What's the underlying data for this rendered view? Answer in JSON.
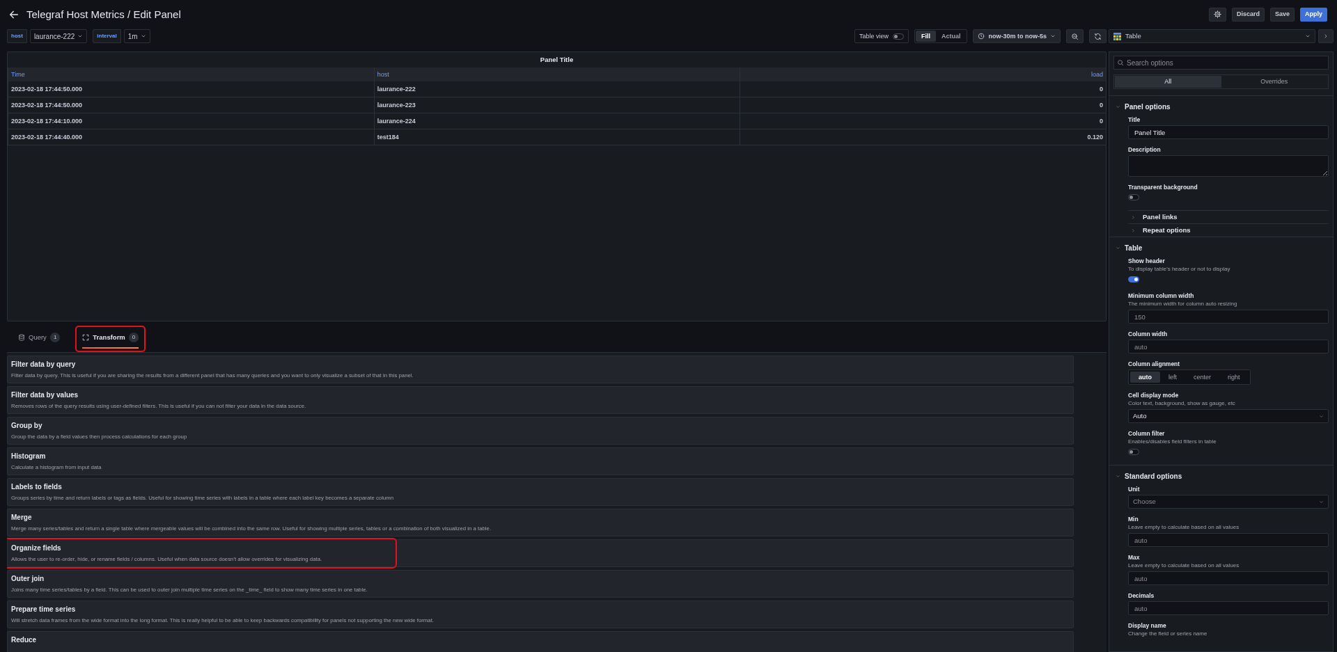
{
  "header": {
    "title": "Telegraf Host Metrics / Edit Panel",
    "buttons": [
      {
        "label": "Discard",
        "kind": "secondary"
      },
      {
        "label": "Save",
        "kind": "secondary"
      },
      {
        "label": "Apply",
        "kind": "primary"
      }
    ]
  },
  "variables": [
    {
      "label": "host",
      "value": "laurance-222"
    },
    {
      "label": "interval",
      "value": "1m"
    }
  ],
  "toolbar": {
    "table_view": {
      "label": "Table view",
      "on": false
    },
    "display_modes": [
      {
        "label": "Fill",
        "selected": true
      },
      {
        "label": "Actual",
        "selected": false
      }
    ],
    "time_range": "now-30m to now-5s"
  },
  "panel": {
    "title": "Panel Title",
    "table": {
      "columns": [
        {
          "label": "Time"
        },
        {
          "label": "host"
        },
        {
          "label": "load"
        }
      ],
      "rows": [
        [
          "2023-02-18 17:44:50.000",
          "laurance-222",
          "0"
        ],
        [
          "2023-02-18 17:44:50.000",
          "laurance-223",
          "0"
        ],
        [
          "2023-02-18 17:44:10.000",
          "laurance-224",
          "0"
        ],
        [
          "2023-02-18 17:44:40.000",
          "test184",
          "0.120"
        ]
      ]
    }
  },
  "tabs": [
    {
      "label": "Query",
      "count": "1",
      "selected": false,
      "highlighted": false
    },
    {
      "label": "Transform",
      "count": "0",
      "selected": true,
      "highlighted": true
    }
  ],
  "transformations": [
    {
      "title": "Filter data by query",
      "description": "Filter data by query. This is useful if you are sharing the results from a different panel that has many queries and you want to only visualize a subset of that in this panel.",
      "highlighted": false
    },
    {
      "title": "Filter data by values",
      "description": "Removes rows of the query results using user-defined filters. This is useful if you can not filter your data in the data source.",
      "highlighted": false
    },
    {
      "title": "Group by",
      "description": "Group the data by a field values then process calculations for each group",
      "highlighted": false
    },
    {
      "title": "Histogram",
      "description": "Calculate a histogram from input data",
      "highlighted": false
    },
    {
      "title": "Labels to fields",
      "description": "Groups series by time and return labels or tags as fields. Useful for showing time series with labels in a table where each label key becomes a separate column",
      "highlighted": false
    },
    {
      "title": "Merge",
      "description": "Merge many series/tables and return a single table where mergeable values will be combined into the same row. Useful for showing multiple series, tables or a combination of both visualized in a table.",
      "highlighted": false
    },
    {
      "title": "Organize fields",
      "description": "Allows the user to re-order, hide, or rename fields / columns. Useful when data source doesn't allow overrides for visualizing data.",
      "highlighted": true
    },
    {
      "title": "Outer join",
      "description": "Joins many time series/tables by a field. This can be used to outer join multiple time series on the _time_ field to show many time series in one table.",
      "highlighted": false
    },
    {
      "title": "Prepare time series",
      "description": "Will stretch data frames from the wide format into the long format. This is really helpful to be able to keep backwards compatibility for panels not supporting the new wide format.",
      "highlighted": false
    },
    {
      "title": "Reduce",
      "highlighted": false
    }
  ],
  "options_pane": {
    "visualization": "Table",
    "search": {
      "placeholder": "Search options"
    },
    "modes": [
      {
        "label": "All",
        "selected": true
      },
      {
        "label": "Overrides",
        "selected": false
      }
    ],
    "sections": [
      {
        "title": "Panel options",
        "expanded": true,
        "items": [
          {
            "kind": "input",
            "label": "Title",
            "value": "Panel Title"
          },
          {
            "kind": "textarea",
            "label": "Description"
          },
          {
            "kind": "switch",
            "label": "Transparent background",
            "on": false
          },
          {
            "kind": "category",
            "label": "Panel links",
            "expanded": false
          },
          {
            "kind": "category",
            "label": "Repeat options",
            "expanded": false
          }
        ]
      },
      {
        "title": "Table",
        "expanded": true,
        "items": [
          {
            "kind": "switch",
            "label": "Show header",
            "description": "To display table's header or not to display",
            "on": true
          },
          {
            "kind": "input",
            "label": "Minimum column width",
            "description": "The minimum width for column auto resizing",
            "placeholder": "150"
          },
          {
            "kind": "input",
            "label": "Column width",
            "placeholder": "auto"
          },
          {
            "kind": "radio",
            "label": "Column alignment",
            "options": [
              {
                "label": "auto",
                "selected": true
              },
              {
                "label": "left",
                "selected": false
              },
              {
                "label": "center",
                "selected": false
              },
              {
                "label": "right",
                "selected": false
              }
            ]
          },
          {
            "kind": "select",
            "label": "Cell display mode",
            "description": "Color text, background, show as gauge, etc",
            "value": "Auto"
          },
          {
            "kind": "switch",
            "label": "Column filter",
            "description": "Enables/disables field filters in table",
            "on": false
          }
        ]
      },
      {
        "title": "Standard options",
        "expanded": true,
        "items": [
          {
            "kind": "select",
            "label": "Unit",
            "placeholder": "Choose"
          },
          {
            "kind": "input",
            "label": "Min",
            "description": "Leave empty to calculate based on all values",
            "placeholder": "auto"
          },
          {
            "kind": "input",
            "label": "Max",
            "description": "Leave empty to calculate based on all values",
            "placeholder": "auto"
          },
          {
            "kind": "input",
            "label": "Decimals",
            "placeholder": "auto"
          },
          {
            "kind": "label",
            "label": "Display name",
            "description": "Change the field or series name"
          }
        ]
      }
    ]
  }
}
